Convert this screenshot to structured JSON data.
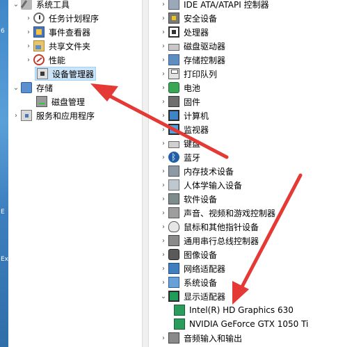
{
  "accent": "#e53935",
  "left_tree": {
    "items": [
      {
        "label": "系统工具",
        "icon": "tools-icon",
        "expander": "expanded"
      },
      {
        "label": "任务计划程序",
        "icon": "clock-icon",
        "expander": "collapsed"
      },
      {
        "label": "事件查看器",
        "icon": "event-viewer-icon",
        "expander": "collapsed"
      },
      {
        "label": "共享文件夹",
        "icon": "shared-folder-icon",
        "expander": "collapsed"
      },
      {
        "label": "性能",
        "icon": "performance-icon",
        "expander": "collapsed"
      },
      {
        "label": "设备管理器",
        "icon": "device-manager-icon",
        "expander": "none",
        "selected": true
      },
      {
        "label": "存储",
        "icon": "storage-icon",
        "expander": "expanded"
      },
      {
        "label": "磁盘管理",
        "icon": "disk-management-icon",
        "expander": "none"
      },
      {
        "label": "服务和应用程序",
        "icon": "services-icon",
        "expander": "collapsed"
      }
    ]
  },
  "device_tree": {
    "categories": [
      {
        "label": "IDE ATA/ATAPI 控制器",
        "icon": "ide-controller-icon",
        "expander": "collapsed"
      },
      {
        "label": "安全设备",
        "icon": "security-device-icon",
        "expander": "collapsed"
      },
      {
        "label": "处理器",
        "icon": "processor-icon",
        "expander": "collapsed"
      },
      {
        "label": "磁盘驱动器",
        "icon": "disk-drive-icon",
        "expander": "collapsed"
      },
      {
        "label": "存储控制器",
        "icon": "storage-controller-icon",
        "expander": "collapsed"
      },
      {
        "label": "打印队列",
        "icon": "printer-icon",
        "expander": "collapsed"
      },
      {
        "label": "电池",
        "icon": "battery-icon",
        "expander": "collapsed"
      },
      {
        "label": "固件",
        "icon": "firmware-icon",
        "expander": "collapsed"
      },
      {
        "label": "计算机",
        "icon": "computer-icon",
        "expander": "collapsed"
      },
      {
        "label": "监视器",
        "icon": "monitor-icon",
        "expander": "collapsed"
      },
      {
        "label": "键盘",
        "icon": "keyboard-icon",
        "expander": "collapsed"
      },
      {
        "label": "蓝牙",
        "icon": "bluetooth-icon",
        "expander": "collapsed"
      },
      {
        "label": "内存技术设备",
        "icon": "memory-tech-icon",
        "expander": "collapsed"
      },
      {
        "label": "人体学输入设备",
        "icon": "hid-icon",
        "expander": "collapsed"
      },
      {
        "label": "软件设备",
        "icon": "software-device-icon",
        "expander": "collapsed"
      },
      {
        "label": "声音、视频和游戏控制器",
        "icon": "audio-video-icon",
        "expander": "collapsed"
      },
      {
        "label": "鼠标和其他指针设备",
        "icon": "mouse-icon",
        "expander": "collapsed"
      },
      {
        "label": "通用串行总线控制器",
        "icon": "usb-icon",
        "expander": "collapsed"
      },
      {
        "label": "图像设备",
        "icon": "camera-icon",
        "expander": "collapsed"
      },
      {
        "label": "网络适配器",
        "icon": "network-adapter-icon",
        "expander": "collapsed"
      },
      {
        "label": "系统设备",
        "icon": "system-device-icon",
        "expander": "collapsed"
      },
      {
        "label": "显示适配器",
        "icon": "display-adapter-icon",
        "expander": "expanded"
      },
      {
        "label": "Intel(R) HD Graphics 630",
        "icon": "gpu-icon",
        "expander": "none",
        "child": true
      },
      {
        "label": "NVIDIA GeForce GTX 1050 Ti",
        "icon": "gpu-icon",
        "expander": "none",
        "child": true
      },
      {
        "label": "音频输入和输出",
        "icon": "audio-io-icon",
        "expander": "collapsed"
      }
    ]
  }
}
